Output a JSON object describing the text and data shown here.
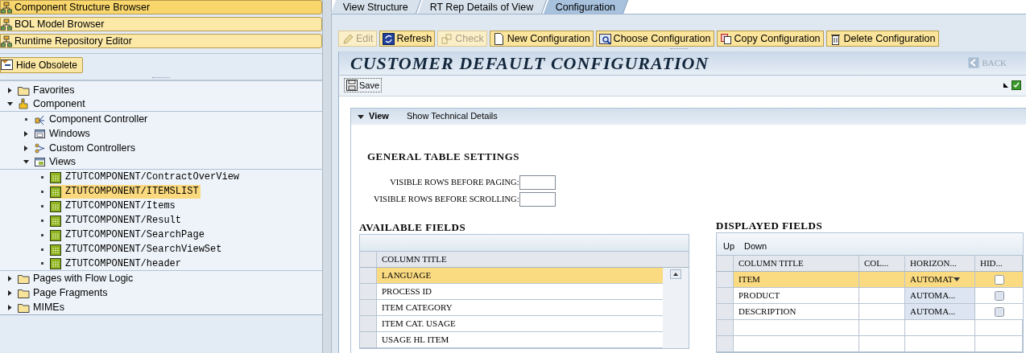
{
  "left_panel": {
    "nav_buttons": [
      {
        "label": "Component Structure Browser",
        "selected": true
      },
      {
        "label": "BOL Model Browser",
        "selected": false
      },
      {
        "label": "Runtime Repository Editor",
        "selected": false
      }
    ],
    "filter_button": "Hide Obsolete",
    "tree": [
      {
        "label": "Favorites",
        "kind": "folder",
        "expanded": false
      },
      {
        "label": "Component",
        "kind": "component",
        "expanded": true,
        "children": [
          {
            "label": "Component Controller",
            "kind": "controller"
          },
          {
            "label": "Windows",
            "kind": "window",
            "expanded": false
          },
          {
            "label": "Custom Controllers",
            "kind": "controllers",
            "expanded": false
          },
          {
            "label": "Views",
            "kind": "views",
            "expanded": true,
            "children": [
              {
                "label": "ZTUTCOMPONENT/ContractOverView",
                "kind": "view",
                "selected": false
              },
              {
                "label": "ZTUTCOMPONENT/ITEMSLIST",
                "kind": "view",
                "selected": true
              },
              {
                "label": "ZTUTCOMPONENT/Items",
                "kind": "view",
                "selected": false
              },
              {
                "label": "ZTUTCOMPONENT/Result",
                "kind": "view",
                "selected": false
              },
              {
                "label": "ZTUTCOMPONENT/SearchPage",
                "kind": "view",
                "selected": false
              },
              {
                "label": "ZTUTCOMPONENT/SearchViewSet",
                "kind": "view",
                "selected": false
              },
              {
                "label": "ZTUTCOMPONENT/header",
                "kind": "view",
                "selected": false
              }
            ]
          }
        ]
      },
      {
        "label": "Pages with Flow Logic",
        "kind": "folder",
        "expanded": false
      },
      {
        "label": "Page Fragments",
        "kind": "folder",
        "expanded": false
      },
      {
        "label": "MIMEs",
        "kind": "folder",
        "expanded": false
      }
    ]
  },
  "tabs": [
    {
      "label": "View Structure",
      "selected": false
    },
    {
      "label": "RT Rep Details of View",
      "selected": false
    },
    {
      "label": "Configuration",
      "selected": true
    }
  ],
  "toolbar": [
    {
      "label": "Edit",
      "kind": "edit",
      "disabled": true
    },
    {
      "label": "Refresh",
      "kind": "refresh",
      "disabled": false
    },
    {
      "label": "Check",
      "kind": "check",
      "disabled": true
    },
    {
      "label": "New Configuration",
      "kind": "new",
      "disabled": false
    },
    {
      "label": "Choose Configuration",
      "kind": "choose",
      "disabled": false
    },
    {
      "label": "Copy Configuration",
      "kind": "copy",
      "disabled": false
    },
    {
      "label": "Delete Configuration",
      "kind": "delete",
      "disabled": false
    }
  ],
  "page_title": "CUSTOMER DEFAULT CONFIGURATION",
  "back_button": {
    "label": "BACK",
    "disabled": true
  },
  "save_button": "Save",
  "view_panel": {
    "title": "View",
    "expanded": true,
    "link": "Show Technical Details"
  },
  "general_table_settings": {
    "heading": "GENERAL TABLE SETTINGS",
    "fields": [
      {
        "label": "VISIBLE ROWS BEFORE PAGING:"
      },
      {
        "label": "VISIBLE ROWS BEFORE SCROLLING:"
      }
    ]
  },
  "available_fields": {
    "heading": "AVAILABLE FIELDS",
    "columns": [
      "COLUMN TITLE"
    ],
    "rows": [
      {
        "title": "LANGUAGE",
        "selected": true
      },
      {
        "title": "PROCESS ID",
        "selected": false
      },
      {
        "title": "ITEM CATEGORY",
        "selected": false
      },
      {
        "title": "ITEM CAT. USAGE",
        "selected": false
      },
      {
        "title": "USAGE HL ITEM",
        "selected": false
      }
    ]
  },
  "displayed_fields": {
    "heading": "DISPLAYED FIELDS",
    "actions": [
      "Up",
      "Down"
    ],
    "columns": [
      "COLUMN TITLE",
      "COL...",
      "HORIZON...",
      "HID..."
    ],
    "rows": [
      {
        "title": "ITEM",
        "alignment": "AUTOMAT",
        "selected": true,
        "hidden": false
      },
      {
        "title": "PRODUCT",
        "alignment": "AUTOMA...",
        "selected": false,
        "hidden": false
      },
      {
        "title": "DESCRIPTION",
        "alignment": "AUTOMA...",
        "selected": false,
        "hidden": false
      }
    ]
  }
}
